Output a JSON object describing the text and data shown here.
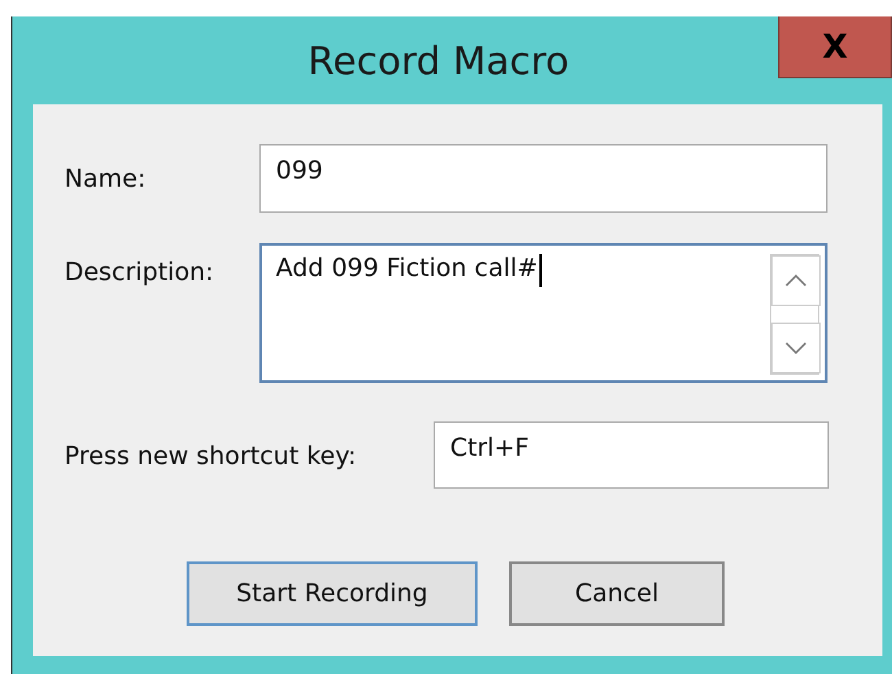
{
  "window": {
    "title": "Record Macro",
    "close_label": "X"
  },
  "fields": [
    {
      "kind": "line",
      "label": "Name:",
      "value": "099",
      "focused": false
    },
    {
      "kind": "multiline",
      "label": "Description:",
      "value": "Add 099 Fiction call#",
      "focused": true
    },
    {
      "kind": "shortcut",
      "label": "Press new shortcut key:",
      "value": "Ctrl+F",
      "focused": false
    }
  ],
  "buttons": [
    {
      "label": "Start Recording",
      "default": true
    },
    {
      "label": "Cancel",
      "default": false
    }
  ]
}
